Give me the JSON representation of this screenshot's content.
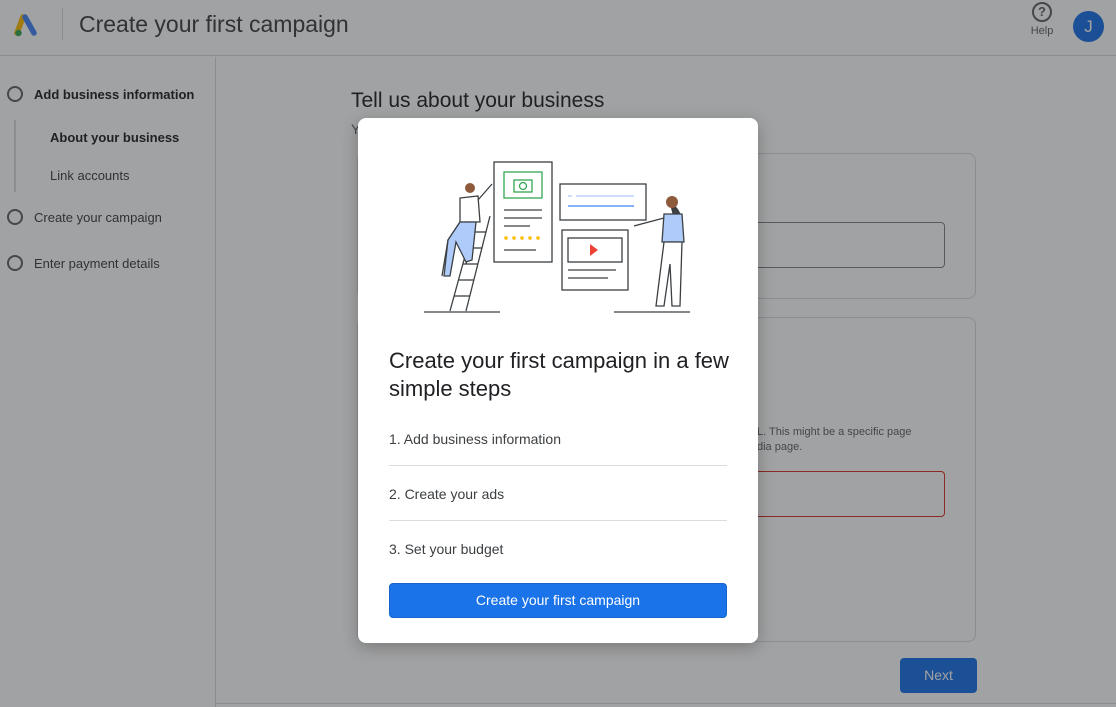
{
  "header": {
    "title": "Create your first campaign",
    "help_label": "Help",
    "help_glyph": "?",
    "avatar_initial": "J",
    "logo_icon": "google-ads-logo",
    "colors": {
      "logo_blue": "#4285F4",
      "logo_yellow": "#FBBC04",
      "logo_green": "#34A853"
    }
  },
  "sidebar": {
    "steps": [
      {
        "label": "Add business information",
        "substeps": [
          "About your business",
          "Link accounts"
        ]
      },
      {
        "label": "Create your campaign"
      },
      {
        "label": "Enter payment details"
      }
    ]
  },
  "main": {
    "title": "Tell us about your business",
    "subtitle_visible": "Y",
    "website_help_text": "L. This might be a specific page",
    "website_help_text_2": "dia page.",
    "next_label": "Next"
  },
  "modal": {
    "illustration_icon": "campaign-setup-illustration",
    "title": "Create your first campaign in a few simple steps",
    "steps": [
      "1. Add business information",
      "2. Create your ads",
      "3. Set your budget"
    ],
    "cta_label": "Create your first campaign"
  },
  "colors": {
    "primary": "#1a73e8",
    "error_outline": "#d93025",
    "scrim": "rgba(32,33,36,0.42)"
  }
}
